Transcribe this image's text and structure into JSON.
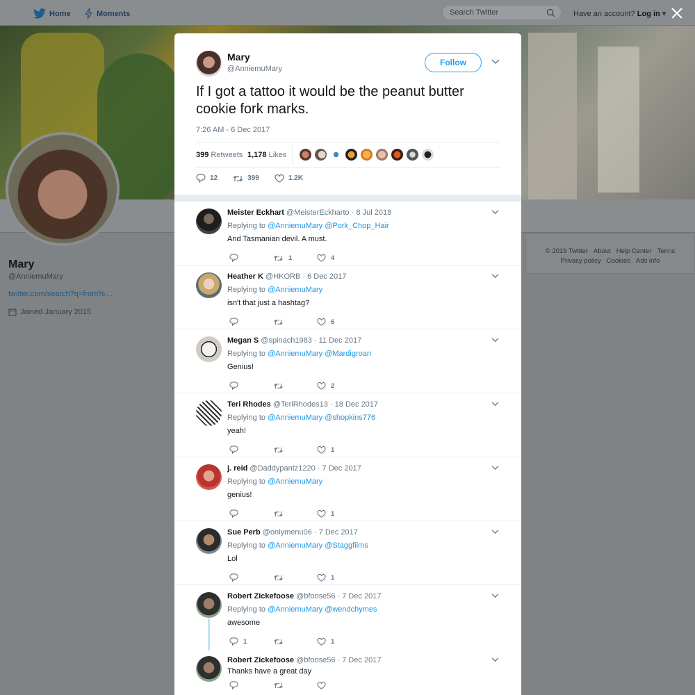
{
  "nav": {
    "home": "Home",
    "moments": "Moments",
    "search_placeholder": "Search Twitter",
    "have_account": "Have an account?",
    "login": "Log in"
  },
  "profile": {
    "name": "Mary",
    "handle": "@AnniemuMary",
    "link": "twitter.com/search?q=from%…",
    "joined": "Joined January 2015"
  },
  "footer": {
    "links": [
      "© 2019 Twitter",
      "About",
      "Help Center",
      "Terms",
      "Privacy policy",
      "Cookies",
      "Ads info"
    ]
  },
  "tweet": {
    "name": "Mary",
    "handle": "@AnniemuMary",
    "follow": "Follow",
    "text": "If I got a tattoo it would be the peanut butter cookie fork marks.",
    "time": "7:26 AM - 6 Dec 2017",
    "retweets_count": "399",
    "retweets_label": "Retweets",
    "likes_count": "1,178",
    "likes_label": "Likes",
    "reply_count": "12",
    "retweet_count": "399",
    "like_count": "1.2K"
  },
  "replies": [
    {
      "name": "Meister Eckhart",
      "handle": "@MeisterEckharto",
      "date": "· 8 Jul 2018",
      "replying": "Replying to",
      "mentions": "@AnniemuMary @Pork_Chop_Hair",
      "text": "And Tasmanian devil.  A must.",
      "replies": "",
      "retweets": "1",
      "likes": "4"
    },
    {
      "name": "Heather K",
      "handle": "@HKORB",
      "date": "· 6 Dec 2017",
      "replying": "Replying to",
      "mentions": "@AnniemuMary",
      "text": "isn't that just a hashtag?",
      "replies": "",
      "retweets": "",
      "likes": "6"
    },
    {
      "name": "Megan S",
      "handle": "@spinach1983",
      "date": "· 11 Dec 2017",
      "replying": "Replying to",
      "mentions": "@AnniemuMary @Mardigroan",
      "text": "Genius!",
      "replies": "",
      "retweets": "",
      "likes": "2"
    },
    {
      "name": "Teri Rhodes",
      "handle": "@TeriRhodes13",
      "date": "· 18 Dec 2017",
      "replying": "Replying to",
      "mentions": "@AnniemuMary @shopkins776",
      "text": "yeah!",
      "replies": "",
      "retweets": "",
      "likes": "1"
    },
    {
      "name": "j. reid",
      "handle": "@Daddypantz1220",
      "date": "· 7 Dec 2017",
      "replying": "Replying to",
      "mentions": "@AnniemuMary",
      "text": "genius!",
      "replies": "",
      "retweets": "",
      "likes": "1"
    },
    {
      "name": "Sue Perb",
      "handle": "@onlymenu06",
      "date": "· 7 Dec 2017",
      "replying": "Replying to",
      "mentions": "@AnniemuMary @Staggfilms",
      "text": "Lol",
      "replies": "",
      "retweets": "",
      "likes": "1"
    },
    {
      "name": "Robert Zickefoose",
      "handle": "@bfoose56",
      "date": "· 7 Dec 2017",
      "replying": "Replying to",
      "mentions": "@AnniemuMary @wendchymes",
      "text": "awesome",
      "replies": "1",
      "retweets": "",
      "likes": "1"
    },
    {
      "name": "Robert Zickefoose",
      "handle": "@bfoose56",
      "date": "· 7 Dec 2017",
      "replying": "",
      "mentions": "",
      "text": "Thanks have a great day",
      "replies": "",
      "retweets": "",
      "likes": ""
    }
  ],
  "colors": {
    "accent": "#1da1f2",
    "link": "#1b95e0",
    "muted": "#657786"
  }
}
